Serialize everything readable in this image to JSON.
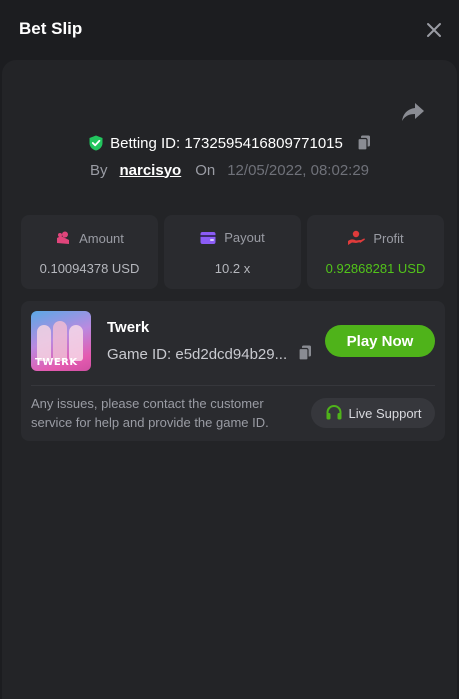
{
  "header": {
    "title": "Bet Slip"
  },
  "bet": {
    "betting_id": "Betting ID: 1732595416809771015",
    "by_label": "By",
    "username": "narcisyo",
    "on_label": "On",
    "datetime": "12/05/2022, 08:02:29"
  },
  "stats": [
    {
      "label": "Amount",
      "value": "0.10094378 USD",
      "icon": "coins-icon",
      "icon_color": "#e0457b"
    },
    {
      "label": "Payout",
      "value": "10.2 x",
      "icon": "wallet-icon",
      "icon_color": "#8b5cf6"
    },
    {
      "label": "Profit",
      "value": "0.92868281 USD",
      "icon": "hand-coins-icon",
      "icon_color": "#e03b3b",
      "value_color": "#52c41a"
    }
  ],
  "game": {
    "name": "Twerk",
    "game_id": "Game ID: e5d2dcd94b29...",
    "thumb_text": "TWERK",
    "play_label": "Play Now",
    "notice": "Any issues, please contact the customer service for help and provide the game ID.",
    "support_label": "Live Support"
  },
  "colors": {
    "accent_green": "#4fb31a",
    "profit_green": "#52c41a",
    "shield_green": "#22c55e"
  }
}
